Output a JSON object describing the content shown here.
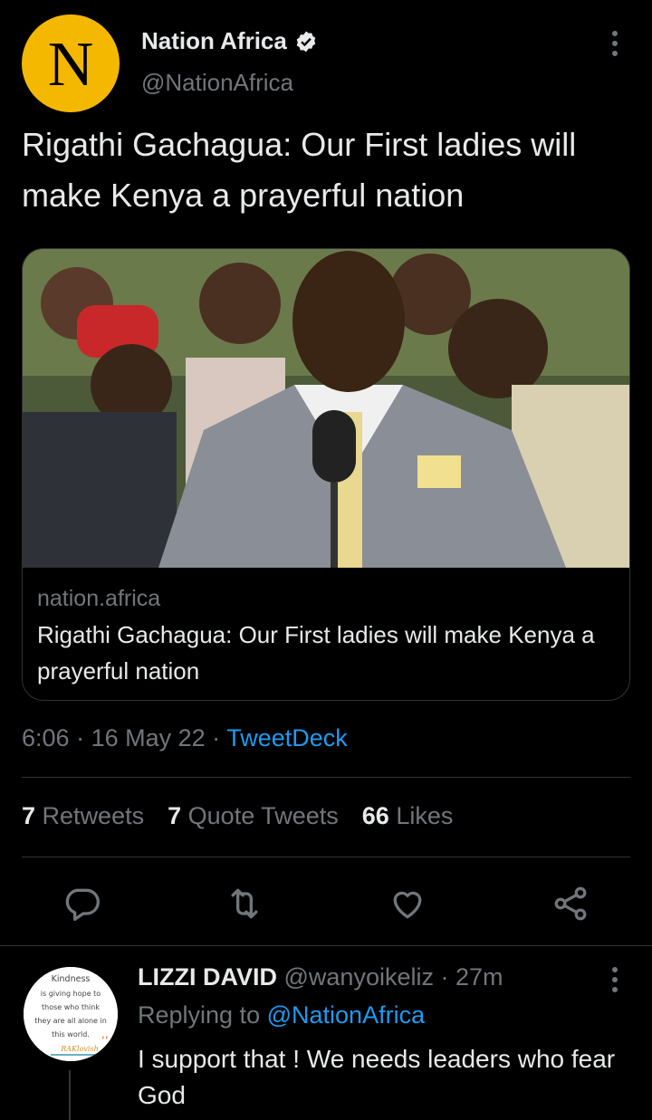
{
  "tweet": {
    "author_name": "Nation Africa",
    "author_handle": "@NationAfrica",
    "avatar_letter": "N",
    "text": "Rigathi Gachagua: Our First ladies will make Kenya a prayerful nation",
    "card": {
      "domain": "nation.africa",
      "title": "Rigathi Gachagua: Our First ladies will make Kenya a prayerful nation"
    },
    "time": "6:06",
    "date": "16 May 22",
    "source": "TweetDeck",
    "stats": {
      "retweets_count": "7",
      "retweets_label": "Retweets",
      "quotes_count": "7",
      "quotes_label": "Quote Tweets",
      "likes_count": "66",
      "likes_label": "Likes"
    }
  },
  "reply": {
    "name": "LIZZI DAVID",
    "handle": "@wanyoikeliz",
    "time": "27m",
    "replying_label": "Replying to",
    "replying_to": "@NationAfrica",
    "text": "I support that ! We needs leaders who fear God",
    "avatar_text": [
      "Kindness",
      "is giving hope to",
      "those who think",
      "they are all alone in",
      "this world.",
      "RAKlovish"
    ]
  },
  "colors": {
    "accent": "#1d9bf0",
    "background": "#000000",
    "avatar_bg": "#f5b800"
  }
}
